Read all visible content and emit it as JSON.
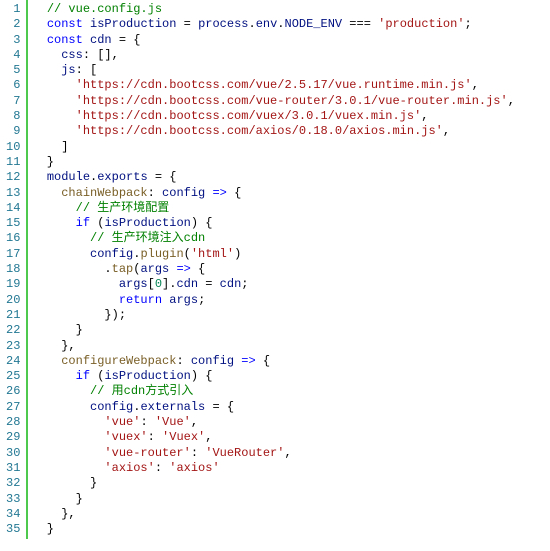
{
  "line_count": 35,
  "lines": [
    [
      {
        "c": "tok-plain",
        "t": "  "
      },
      {
        "c": "tok-comment",
        "t": "// vue.config.js"
      }
    ],
    [
      {
        "c": "tok-plain",
        "t": "  "
      },
      {
        "c": "tok-keyword",
        "t": "const"
      },
      {
        "c": "tok-plain",
        "t": " "
      },
      {
        "c": "tok-ident",
        "t": "isProduction"
      },
      {
        "c": "tok-plain",
        "t": " = "
      },
      {
        "c": "tok-ident",
        "t": "process"
      },
      {
        "c": "tok-plain",
        "t": "."
      },
      {
        "c": "tok-ident",
        "t": "env"
      },
      {
        "c": "tok-plain",
        "t": "."
      },
      {
        "c": "tok-ident",
        "t": "NODE_ENV"
      },
      {
        "c": "tok-plain",
        "t": " === "
      },
      {
        "c": "tok-string",
        "t": "'production'"
      },
      {
        "c": "tok-plain",
        "t": ";"
      }
    ],
    [
      {
        "c": "tok-plain",
        "t": "  "
      },
      {
        "c": "tok-keyword",
        "t": "const"
      },
      {
        "c": "tok-plain",
        "t": " "
      },
      {
        "c": "tok-ident",
        "t": "cdn"
      },
      {
        "c": "tok-plain",
        "t": " = {"
      }
    ],
    [
      {
        "c": "tok-plain",
        "t": "    "
      },
      {
        "c": "tok-ident",
        "t": "css"
      },
      {
        "c": "tok-plain",
        "t": ": [],"
      }
    ],
    [
      {
        "c": "tok-plain",
        "t": "    "
      },
      {
        "c": "tok-ident",
        "t": "js"
      },
      {
        "c": "tok-plain",
        "t": ": ["
      }
    ],
    [
      {
        "c": "tok-plain",
        "t": "      "
      },
      {
        "c": "tok-string",
        "t": "'https://cdn.bootcss.com/vue/2.5.17/vue.runtime.min.js'"
      },
      {
        "c": "tok-plain",
        "t": ","
      }
    ],
    [
      {
        "c": "tok-plain",
        "t": "      "
      },
      {
        "c": "tok-string",
        "t": "'https://cdn.bootcss.com/vue-router/3.0.1/vue-router.min.js'"
      },
      {
        "c": "tok-plain",
        "t": ","
      }
    ],
    [
      {
        "c": "tok-plain",
        "t": "      "
      },
      {
        "c": "tok-string",
        "t": "'https://cdn.bootcss.com/vuex/3.0.1/vuex.min.js'"
      },
      {
        "c": "tok-plain",
        "t": ","
      }
    ],
    [
      {
        "c": "tok-plain",
        "t": "      "
      },
      {
        "c": "tok-string",
        "t": "'https://cdn.bootcss.com/axios/0.18.0/axios.min.js'"
      },
      {
        "c": "tok-plain",
        "t": ","
      }
    ],
    [
      {
        "c": "tok-plain",
        "t": "    ]"
      }
    ],
    [
      {
        "c": "tok-plain",
        "t": "  }"
      }
    ],
    [
      {
        "c": "tok-plain",
        "t": "  "
      },
      {
        "c": "tok-ident",
        "t": "module"
      },
      {
        "c": "tok-plain",
        "t": "."
      },
      {
        "c": "tok-ident",
        "t": "exports"
      },
      {
        "c": "tok-plain",
        "t": " = {"
      }
    ],
    [
      {
        "c": "tok-plain",
        "t": "    "
      },
      {
        "c": "tok-func",
        "t": "chainWebpack"
      },
      {
        "c": "tok-plain",
        "t": ": "
      },
      {
        "c": "tok-ident",
        "t": "config"
      },
      {
        "c": "tok-plain",
        "t": " "
      },
      {
        "c": "tok-keyword",
        "t": "=>"
      },
      {
        "c": "tok-plain",
        "t": " {"
      }
    ],
    [
      {
        "c": "tok-plain",
        "t": "      "
      },
      {
        "c": "tok-comment",
        "t": "// 生产环境配置"
      }
    ],
    [
      {
        "c": "tok-plain",
        "t": "      "
      },
      {
        "c": "tok-keyword",
        "t": "if"
      },
      {
        "c": "tok-plain",
        "t": " ("
      },
      {
        "c": "tok-ident",
        "t": "isProduction"
      },
      {
        "c": "tok-plain",
        "t": ") {"
      }
    ],
    [
      {
        "c": "tok-plain",
        "t": "        "
      },
      {
        "c": "tok-comment",
        "t": "// 生产环境注入cdn"
      }
    ],
    [
      {
        "c": "tok-plain",
        "t": "        "
      },
      {
        "c": "tok-ident",
        "t": "config"
      },
      {
        "c": "tok-plain",
        "t": "."
      },
      {
        "c": "tok-func",
        "t": "plugin"
      },
      {
        "c": "tok-plain",
        "t": "("
      },
      {
        "c": "tok-string",
        "t": "'html'"
      },
      {
        "c": "tok-plain",
        "t": ")"
      }
    ],
    [
      {
        "c": "tok-plain",
        "t": "          ."
      },
      {
        "c": "tok-func",
        "t": "tap"
      },
      {
        "c": "tok-plain",
        "t": "("
      },
      {
        "c": "tok-ident",
        "t": "args"
      },
      {
        "c": "tok-plain",
        "t": " "
      },
      {
        "c": "tok-keyword",
        "t": "=>"
      },
      {
        "c": "tok-plain",
        "t": " {"
      }
    ],
    [
      {
        "c": "tok-plain",
        "t": "            "
      },
      {
        "c": "tok-ident",
        "t": "args"
      },
      {
        "c": "tok-plain",
        "t": "["
      },
      {
        "c": "tok-number",
        "t": "0"
      },
      {
        "c": "tok-plain",
        "t": "]."
      },
      {
        "c": "tok-ident",
        "t": "cdn"
      },
      {
        "c": "tok-plain",
        "t": " = "
      },
      {
        "c": "tok-ident",
        "t": "cdn"
      },
      {
        "c": "tok-plain",
        "t": ";"
      }
    ],
    [
      {
        "c": "tok-plain",
        "t": "            "
      },
      {
        "c": "tok-keyword",
        "t": "return"
      },
      {
        "c": "tok-plain",
        "t": " "
      },
      {
        "c": "tok-ident",
        "t": "args"
      },
      {
        "c": "tok-plain",
        "t": ";"
      }
    ],
    [
      {
        "c": "tok-plain",
        "t": "          });"
      }
    ],
    [
      {
        "c": "tok-plain",
        "t": "      }"
      }
    ],
    [
      {
        "c": "tok-plain",
        "t": "    },"
      }
    ],
    [
      {
        "c": "tok-plain",
        "t": "    "
      },
      {
        "c": "tok-func",
        "t": "configureWebpack"
      },
      {
        "c": "tok-plain",
        "t": ": "
      },
      {
        "c": "tok-ident",
        "t": "config"
      },
      {
        "c": "tok-plain",
        "t": " "
      },
      {
        "c": "tok-keyword",
        "t": "=>"
      },
      {
        "c": "tok-plain",
        "t": " {"
      }
    ],
    [
      {
        "c": "tok-plain",
        "t": "      "
      },
      {
        "c": "tok-keyword",
        "t": "if"
      },
      {
        "c": "tok-plain",
        "t": " ("
      },
      {
        "c": "tok-ident",
        "t": "isProduction"
      },
      {
        "c": "tok-plain",
        "t": ") {"
      }
    ],
    [
      {
        "c": "tok-plain",
        "t": "        "
      },
      {
        "c": "tok-comment",
        "t": "// 用cdn方式引入"
      }
    ],
    [
      {
        "c": "tok-plain",
        "t": "        "
      },
      {
        "c": "tok-ident",
        "t": "config"
      },
      {
        "c": "tok-plain",
        "t": "."
      },
      {
        "c": "tok-ident",
        "t": "externals"
      },
      {
        "c": "tok-plain",
        "t": " = {"
      }
    ],
    [
      {
        "c": "tok-plain",
        "t": "          "
      },
      {
        "c": "tok-string",
        "t": "'vue'"
      },
      {
        "c": "tok-plain",
        "t": ": "
      },
      {
        "c": "tok-string",
        "t": "'Vue'"
      },
      {
        "c": "tok-plain",
        "t": ","
      }
    ],
    [
      {
        "c": "tok-plain",
        "t": "          "
      },
      {
        "c": "tok-string",
        "t": "'vuex'"
      },
      {
        "c": "tok-plain",
        "t": ": "
      },
      {
        "c": "tok-string",
        "t": "'Vuex'"
      },
      {
        "c": "tok-plain",
        "t": ","
      }
    ],
    [
      {
        "c": "tok-plain",
        "t": "          "
      },
      {
        "c": "tok-string",
        "t": "'vue-router'"
      },
      {
        "c": "tok-plain",
        "t": ": "
      },
      {
        "c": "tok-string",
        "t": "'VueRouter'"
      },
      {
        "c": "tok-plain",
        "t": ","
      }
    ],
    [
      {
        "c": "tok-plain",
        "t": "          "
      },
      {
        "c": "tok-string",
        "t": "'axios'"
      },
      {
        "c": "tok-plain",
        "t": ": "
      },
      {
        "c": "tok-string",
        "t": "'axios'"
      }
    ],
    [
      {
        "c": "tok-plain",
        "t": "        }"
      }
    ],
    [
      {
        "c": "tok-plain",
        "t": "      }"
      }
    ],
    [
      {
        "c": "tok-plain",
        "t": "    },"
      }
    ],
    [
      {
        "c": "tok-plain",
        "t": "  }"
      }
    ]
  ]
}
